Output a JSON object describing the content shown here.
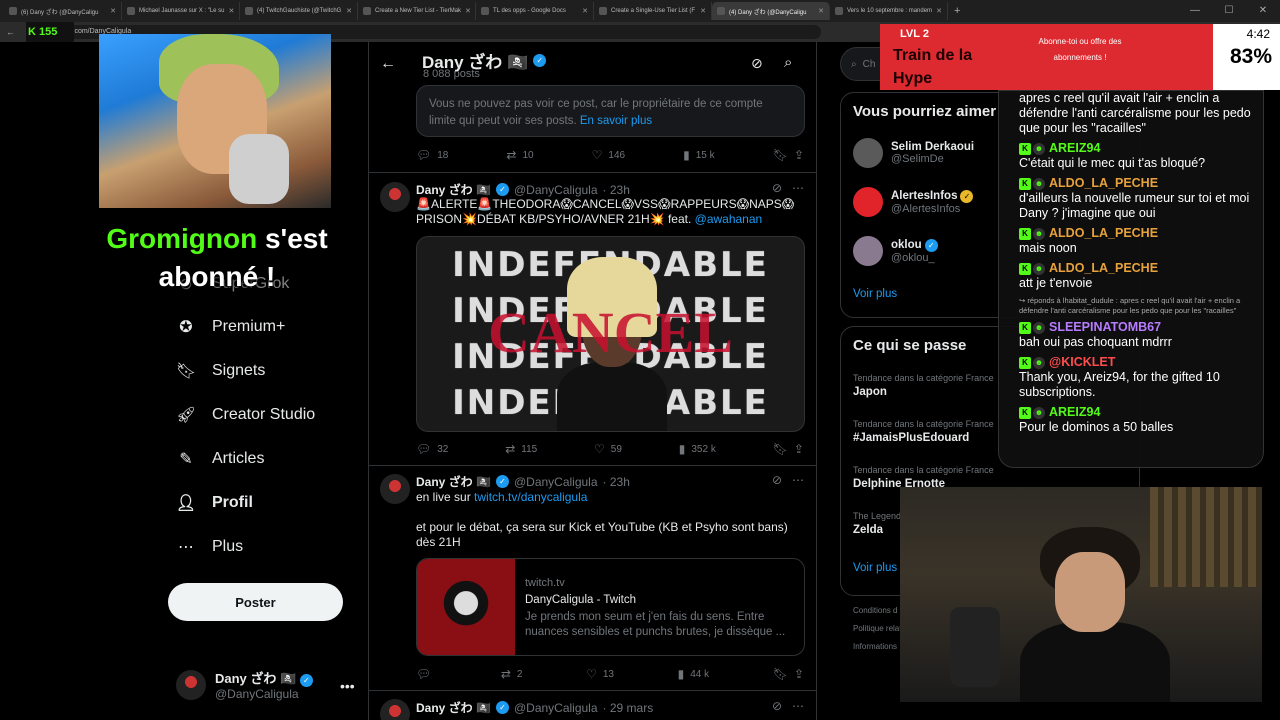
{
  "browser": {
    "tabs": [
      {
        "title": "(6) Dany ざわ (@DanyCaligu",
        "active": false
      },
      {
        "title": "Michael Jaunasse sur X : \"Le su",
        "active": false
      },
      {
        "title": "(4) TwitchGauchiste (@TwitchG",
        "active": false
      },
      {
        "title": "Create a New Tier List - TierMak",
        "active": false
      },
      {
        "title": "TL des opps - Google Docs",
        "active": false
      },
      {
        "title": "Create a Single-Use Tier List (F",
        "active": false
      },
      {
        "title": "(4) Dany ざわ (@DanyCaligu",
        "active": true
      },
      {
        "title": "Vers le 10 septembre : mandem",
        "active": false
      }
    ],
    "url": "x.com/DanyCaligula",
    "kick_logo": "K 155"
  },
  "stream_overlay": {
    "sub_alert": {
      "name": "Gromignon",
      "text": "s'est abonné !"
    },
    "hype_train": {
      "level": "LVL 2",
      "title": "Train de la Hype",
      "cta": "Abonne-toi ou offre des abonnements !",
      "time": "4:42",
      "percent": "83%"
    },
    "chat": [
      {
        "user": "",
        "text": "apres c reel qu'il avait l'air + enclin a défendre l'anti carcéralisme pour les pedo que pour les \"racailles\"",
        "color": "#ffffff"
      },
      {
        "user": "AREIZ94",
        "text": "C'était qui le mec qui t'as bloqué?",
        "color": "#53fc18"
      },
      {
        "user": "ALDO_LA_PECHE",
        "text": "d'ailleurs la nouvelle rumeur sur toi et moi Dany ? j'imagine que oui",
        "color": "#e8a23c"
      },
      {
        "user": "ALDO_LA_PECHE",
        "text": "mais noon",
        "color": "#e8a23c"
      },
      {
        "user": "ALDO_LA_PECHE",
        "text": "att je t'envoie",
        "color": "#e8a23c"
      },
      {
        "reply": "↪ réponds à lhabitat_dudule : apres c reel qu'il avait l'air + enclin a défendre l'anti carcéralisme pour les pedo que pour les \"racailles\""
      },
      {
        "user": "SLEEPINATOMB67",
        "text": "bah oui pas choquant mdrrr",
        "color": "#b77cff"
      },
      {
        "user": "@KICKLET",
        "text": "Thank you, Areiz94, for the gifted 10 subscriptions.",
        "color": "#ff4d4d"
      },
      {
        "user": "AREIZ94",
        "text": "Pour le dominos a 50 balles",
        "color": "#53fc18"
      }
    ]
  },
  "nav": {
    "grok": "SuperGrok",
    "items": [
      {
        "label": "Premium+",
        "icon": "premium-icon",
        "glyph": "✪",
        "bold": false
      },
      {
        "label": "Signets",
        "icon": "bookmark-icon",
        "glyph": "🔖︎",
        "bold": false
      },
      {
        "label": "Creator Studio",
        "icon": "rocket-icon",
        "glyph": "🚀︎",
        "bold": false
      },
      {
        "label": "Articles",
        "icon": "article-icon",
        "glyph": "✎",
        "bold": false
      },
      {
        "label": "Profil",
        "icon": "person-icon",
        "glyph": "👤︎",
        "bold": true
      },
      {
        "label": "Plus",
        "icon": "more-icon",
        "glyph": "⋯",
        "bold": false
      }
    ],
    "post_button": "Poster",
    "account": {
      "name": "Dany ざわ 🏴‍☠️",
      "handle": "@DanyCaligula"
    }
  },
  "profile_header": {
    "name": "Dany ざわ 🏴‍☠️",
    "posts_count": "8 088 posts"
  },
  "notice": {
    "text": "Vous ne pouvez pas voir ce post, car le propriétaire de ce compte limite qui peut voir ses posts.",
    "link": "En savoir plus",
    "stats": {
      "replies": "18",
      "reposts": "10",
      "likes": "146",
      "views": "15 k"
    }
  },
  "tweets": [
    {
      "name": "Dany ざわ 🏴‍☠️",
      "handle": "@DanyCaligula",
      "time": "· 23h",
      "text": "🚨ALERTE🚨THEODORA😱CANCEL😱VSS😱RAPPEURS😱NAPS😱PRISON💥DÉBAT KB/PSYHO/AVNER 21H💥 feat.",
      "mention": "@awahanan",
      "media_words": [
        "INDEFENDABLE",
        "INDEFENDABLE",
        "INDEFENDABLE",
        "INDEFENDABLE"
      ],
      "media_overlay": "CANCEL",
      "stats": {
        "replies": "32",
        "reposts": "115",
        "likes": "59",
        "views": "352 k"
      }
    },
    {
      "name": "Dany ざわ 🏴‍☠️",
      "handle": "@DanyCaligula",
      "time": "· 23h",
      "text1": "en live sur",
      "link": "twitch.tv/danycaligula",
      "text2": "et pour le débat, ça sera sur Kick et YouTube (KB et Psyho sont bans) dès 21H",
      "card": {
        "host": "twitch.tv",
        "title": "DanyCaligula - Twitch",
        "desc": "Je prends mon seum et j'en fais du sens. Entre nuances sensibles et punchs brutes, je dissèque ..."
      },
      "stats": {
        "replies": "",
        "reposts": "2",
        "likes": "13",
        "views": "44 k"
      }
    },
    {
      "name": "Dany ざわ 🏴‍☠️",
      "handle": "@DanyCaligula",
      "time": "· 29 mars"
    }
  ],
  "right": {
    "search_placeholder": "Ch",
    "who_to_follow": {
      "title": "Vous pourriez aimer",
      "accounts": [
        {
          "name": "Selim Derkaoui",
          "handle": "@SelimDe",
          "badge": "",
          "avatar": "#5a5a5a"
        },
        {
          "name": "AlertesInfos",
          "handle": "@AlertesInfos",
          "badge": "gold",
          "avatar": "#e0242a"
        },
        {
          "name": "oklou",
          "handle": "@oklou_",
          "badge": "blue",
          "avatar": "#8a7a90"
        }
      ],
      "see_more": "Voir plus"
    },
    "trends": {
      "title": "Ce qui se passe",
      "items": [
        {
          "category": "Tendance dans la catégorie France",
          "title": "Japon"
        },
        {
          "category": "Tendance dans la catégorie France",
          "title": "#JamaisPlusEdouard"
        },
        {
          "category": "Tendance dans la catégorie France",
          "title": "Delphine Ernotte"
        },
        {
          "category": "The Legend",
          "title": "Zelda"
        }
      ],
      "see_more": "Voir plus"
    },
    "footer": [
      "Conditions d",
      "Politique relat",
      "Informations"
    ]
  },
  "colors": {
    "accent": "#1d9bf0",
    "kick_green": "#53fc18",
    "hype_red": "#dc2a30"
  }
}
